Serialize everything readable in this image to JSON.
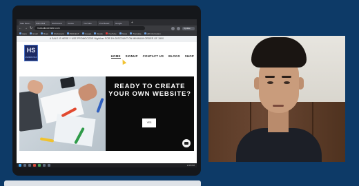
{
  "browser": {
    "tabs": [
      "Sale Rece...",
      "Zoho Mail",
      "Workboard",
      "Canva",
      "YouTube",
      "Prof Board",
      "Google"
    ],
    "url": "hsstudiowebsite.com",
    "profile_button": "Update",
    "bookmarks": [
      "Apps",
      "Gmail",
      "Maps",
      "Workboard",
      "PROJECT",
      "Google",
      "Studio",
      "YouTube",
      "News",
      "Translate",
      "HR Information"
    ]
  },
  "site": {
    "promo_text": "A SALE IS HERE !! USE PROMOCODE Nightloer FOR 5% DISCOUNT ON MINIMUM ORDER OF 1500",
    "logo_mark": "HS",
    "logo_sub": "HSWEBSITES",
    "nav": [
      "HOME",
      "SIGNUP",
      "CONTACT US",
      "BLOGS",
      "SHOP"
    ],
    "hero_title": "READY TO CREATE YOUR OWN WEBSITE?",
    "hero_button": "YES"
  },
  "taskbar": {
    "clock": "2:25 PM"
  },
  "colors": {
    "background": "#0d3a67",
    "hero_dark": "#0b0b0b",
    "promo_bg": "#eef0f2"
  }
}
